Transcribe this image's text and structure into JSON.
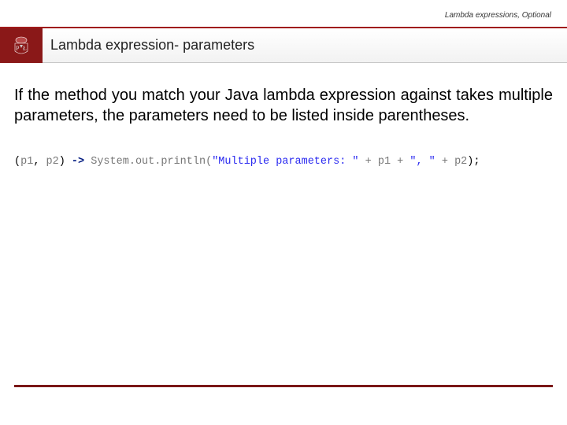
{
  "header": {
    "breadcrumb": "Lambda expressions, Optional",
    "logo_text_top": "P",
    "logo_text_right": "Ł",
    "title": "Lambda expression- parameters"
  },
  "body": {
    "paragraph": "If the method you match your Java lambda expression against takes multiple parameters, the parameters need to be listed inside parentheses."
  },
  "code": {
    "open_paren": "(",
    "p1": "p1",
    "comma1": ", ",
    "p2": "p2",
    "close_paren": ") ",
    "arrow": "->",
    "space": " ",
    "call1": "System.",
    "out": "out",
    "call2": ".println(",
    "str1": "\"Multiple parameters: \"",
    "plus1": " + ",
    "arg1": "p1",
    "plus2": " + ",
    "str2": "\", \"",
    "plus3": " + ",
    "arg2": "p2",
    "end": ");"
  }
}
